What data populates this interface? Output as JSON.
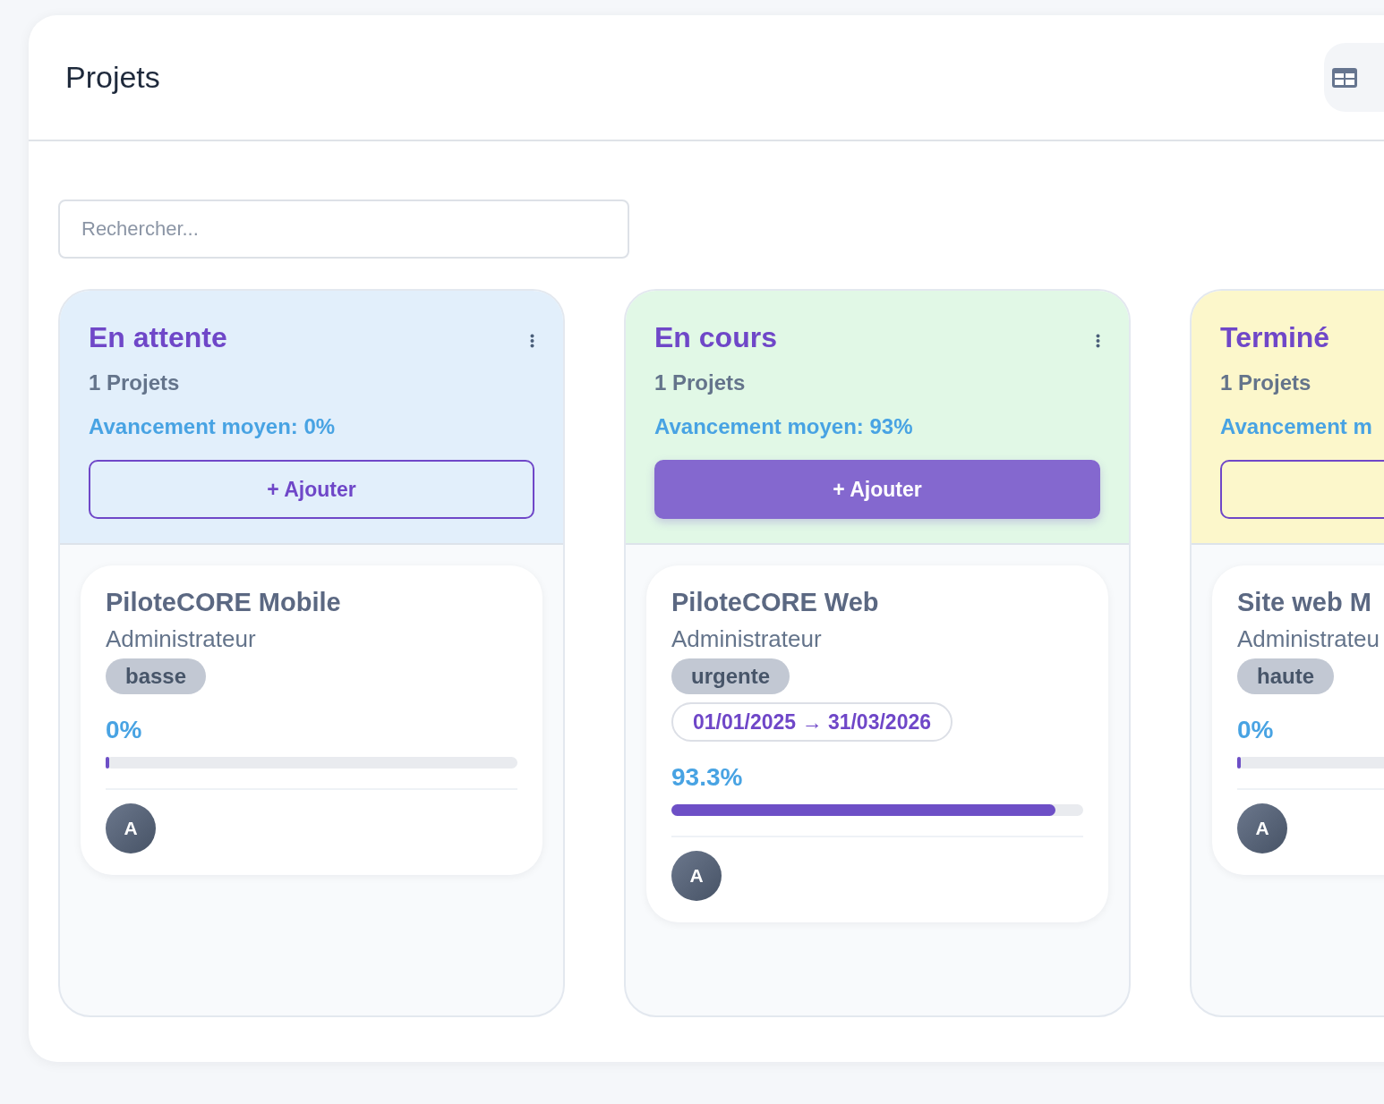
{
  "header": {
    "title": "Projets"
  },
  "search": {
    "placeholder": "Rechercher..."
  },
  "columns": [
    {
      "title": "En attente",
      "color": "#e2effb",
      "count": "1 Projets",
      "average": "Avancement moyen: 0%",
      "add_button": {
        "label": "+ Ajouter",
        "highlighted": false
      },
      "projects": [
        {
          "name": "PiloteCORE Mobile",
          "owner": "Administrateur",
          "priority": "basse",
          "progress": "0%",
          "level": 0,
          "avatar": "A"
        }
      ]
    },
    {
      "title": "En cours",
      "color": "#e1f8e6",
      "count": "1 Projets",
      "average": "Avancement moyen: 93%",
      "add_button": {
        "label": "+ Ajouter",
        "highlighted": true
      },
      "projects": [
        {
          "name": "PiloteCORE Web",
          "owner": "Administrateur",
          "priority": "urgente",
          "dates": "01/01/2025 → 31/03/2026",
          "progress": "93.3%",
          "level": 0.933,
          "avatar": "A"
        }
      ]
    },
    {
      "title": "Terminé",
      "color": "#fcf7cb",
      "count": "1 Projets",
      "average": "Avancement m",
      "add_button": {
        "highlighted": false
      },
      "projects": [
        {
          "name": "Site web M",
          "owner": "Administrateu",
          "priority": "haute",
          "progress": "0%",
          "level": 0,
          "avatar": "A"
        }
      ]
    }
  ]
}
